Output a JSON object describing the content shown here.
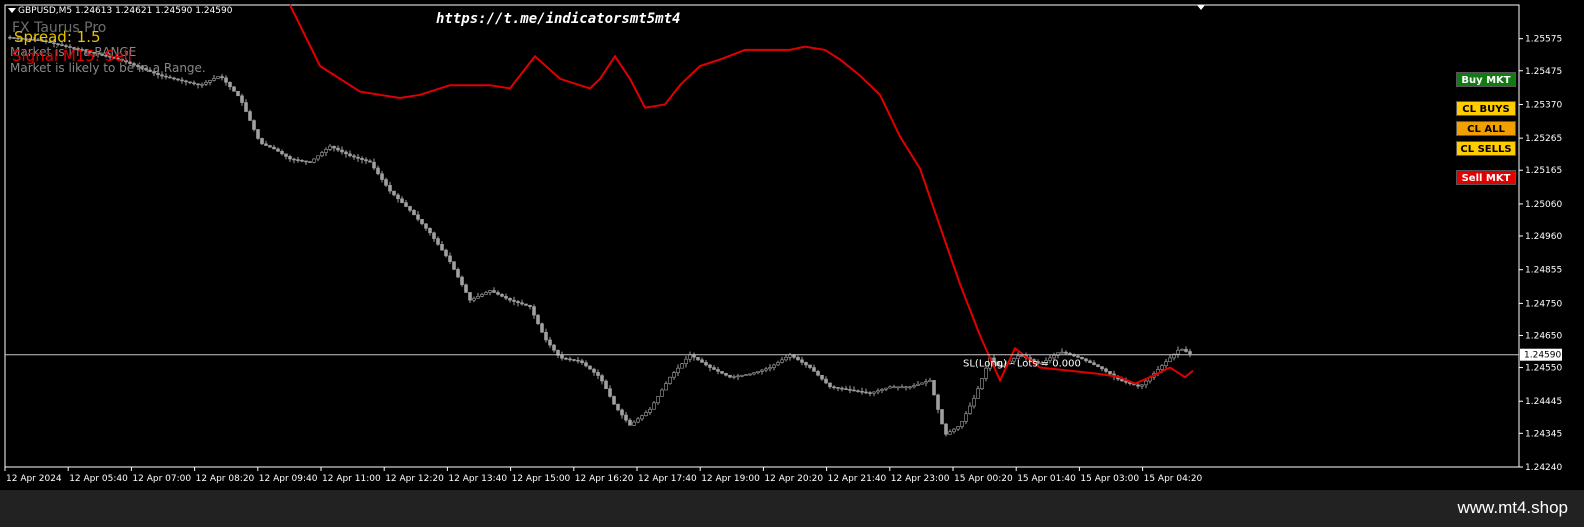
{
  "header": {
    "symbol_line": "GBPUSD,M5  1.24613 1.24621 1.24590 1.24590",
    "url": "https://t.me/indicatorsmt5mt4"
  },
  "indicator": {
    "name": "FX Taurus Pro",
    "spread": "Spread: 1.5",
    "market_state": "Market is in a RANGE",
    "signal": "Signal M15: Sell",
    "market_forecast": "Market is likely to be in a Range."
  },
  "buttons": {
    "buy": "Buy MKT",
    "cl_buys": "CL BUYS",
    "cl_all": "CL ALL",
    "cl_sells": "CL SELLS",
    "sell": "Sell MKT"
  },
  "colors": {
    "buy": "#127a12",
    "close_buys": "#ffcc00",
    "close_all": "#f0a000",
    "close_sells": "#ffcc00",
    "sell": "#e00000",
    "trend_line": "#e00000",
    "candles": "#a0a0a0",
    "signal_text": "#e00000",
    "spread_text": "#e8c200"
  },
  "price_line": {
    "value": "1.24590",
    "sl_label": "SL(Long) - Lots = 0.000"
  },
  "footer": {
    "watermark": "www.mt4.shop"
  },
  "chart_data": {
    "type": "line",
    "y_ticks": [
      "1.25575",
      "1.25475",
      "1.25370",
      "1.25265",
      "1.25165",
      "1.25060",
      "1.24960",
      "1.24855",
      "1.24750",
      "1.24650",
      "1.24550",
      "1.24445",
      "1.24345",
      "1.24240"
    ],
    "x_ticks": [
      "12 Apr 2024",
      "12 Apr 05:40",
      "12 Apr 07:00",
      "12 Apr 08:20",
      "12 Apr 09:40",
      "12 Apr 11:00",
      "12 Apr 12:20",
      "12 Apr 13:40",
      "12 Apr 15:00",
      "12 Apr 16:20",
      "12 Apr 17:40",
      "12 Apr 19:00",
      "12 Apr 20:20",
      "12 Apr 21:40",
      "12 Apr 23:00",
      "15 Apr 00:20",
      "15 Apr 01:40",
      "15 Apr 03:00",
      "15 Apr 04:20"
    ],
    "ylim": [
      1.2424,
      1.2568
    ],
    "current_price": 1.2459,
    "red_line": {
      "x": [
        290,
        320,
        360,
        400,
        420,
        450,
        490,
        510,
        535,
        560,
        590,
        600,
        615,
        630,
        645,
        665,
        680,
        700,
        720,
        745,
        770,
        790,
        805,
        825,
        840,
        860,
        880,
        900,
        920,
        940,
        960,
        980,
        1000,
        1015,
        1040,
        1070,
        1100,
        1120,
        1135,
        1150,
        1170,
        1185,
        1193
      ],
      "y": [
        1.2568,
        1.2549,
        1.2541,
        1.2539,
        1.254,
        1.2543,
        1.2543,
        1.2542,
        1.2552,
        1.2545,
        1.2542,
        1.2545,
        1.2552,
        1.2545,
        1.2536,
        1.2537,
        1.2543,
        1.2549,
        1.2551,
        1.2554,
        1.2554,
        1.2554,
        1.2555,
        1.2554,
        1.2551,
        1.2546,
        1.254,
        1.2527,
        1.2517,
        1.2499,
        1.2481,
        1.2465,
        1.2451,
        1.2461,
        1.2455,
        1.2454,
        1.2453,
        1.2452,
        1.245,
        1.2452,
        1.2455,
        1.2452,
        1.2454
      ]
    },
    "candle_close": {
      "x": [
        5,
        40,
        80,
        120,
        160,
        200,
        220,
        240,
        260,
        275,
        290,
        310,
        330,
        350,
        370,
        390,
        410,
        430,
        450,
        470,
        490,
        510,
        530,
        545,
        560,
        580,
        600,
        615,
        630,
        650,
        670,
        690,
        710,
        730,
        750,
        770,
        790,
        810,
        830,
        850,
        870,
        890,
        910,
        930,
        945,
        960,
        975,
        990,
        1000,
        1020,
        1040,
        1060,
        1080,
        1100,
        1120,
        1140,
        1160,
        1180,
        1192
      ],
      "y": [
        1.2558,
        1.2557,
        1.2554,
        1.2551,
        1.2546,
        1.2543,
        1.2546,
        1.2539,
        1.2525,
        1.2523,
        1.252,
        1.2519,
        1.2524,
        1.2521,
        1.2519,
        1.251,
        1.2504,
        1.2497,
        1.2488,
        1.2476,
        1.2479,
        1.2476,
        1.2474,
        1.2464,
        1.2458,
        1.2457,
        1.2452,
        1.2443,
        1.2437,
        1.2442,
        1.2452,
        1.2459,
        1.2455,
        1.2452,
        1.2453,
        1.2455,
        1.2459,
        1.2455,
        1.2449,
        1.2448,
        1.2447,
        1.2449,
        1.2449,
        1.2451,
        1.2434,
        1.2437,
        1.2446,
        1.2458,
        1.2455,
        1.2459,
        1.2456,
        1.246,
        1.2458,
        1.2455,
        1.2451,
        1.2449,
        1.2455,
        1.2461,
        1.2459
      ]
    }
  }
}
